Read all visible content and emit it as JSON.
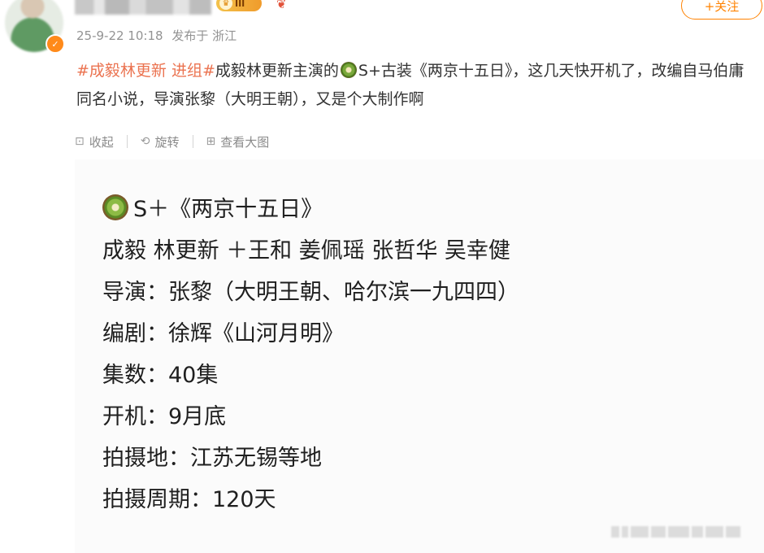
{
  "header": {
    "follow_label": "+关注",
    "level_badge": "III",
    "timestamp": "25-9-22 10:18",
    "source": "发布于 浙江"
  },
  "post": {
    "hashtag1": "#成毅林更新 进组#",
    "text_part1": "成毅林更新主演的",
    "text_part2": "S+古装《两京十五日》，这几天快开机了，改编自马伯庸同名小说，导演张黎（大明王朝），又是个大制作啊"
  },
  "toolbar": {
    "collapse_label": "收起",
    "rotate_label": "旋转",
    "view_large_label": "查看大图"
  },
  "image_card": {
    "lines": [
      "S＋《两京十五日》",
      "成毅 林更新 ＋王和 姜佩瑶 张哲华 吴幸健",
      "导演：张黎（大明王朝、哈尔滨一九四四）",
      "编剧：徐辉《山河月明》",
      "集数：40集",
      "开机：9月底",
      "拍摄地：江苏无锡等地",
      "拍摄周期：120天"
    ]
  },
  "colors": {
    "accent": "#ff8200",
    "hashtag": "#eb7350",
    "meta": "#939393"
  }
}
